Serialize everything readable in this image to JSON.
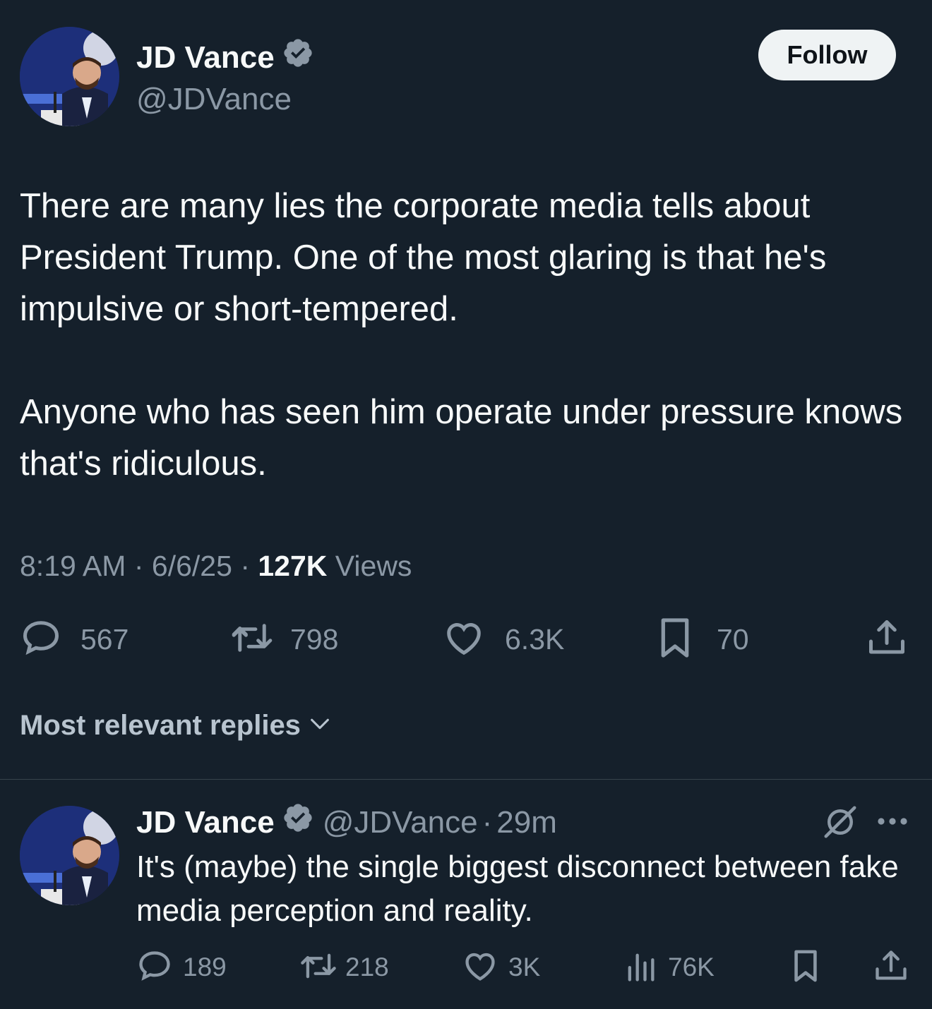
{
  "tweet": {
    "author_name": "JD Vance",
    "handle": "@JDVance",
    "follow_label": "Follow",
    "text_p1": "There are many lies the corporate media tells about President Trump. One of the most glaring is that he's impulsive or short-tempered.",
    "text_p2": "Anyone who has seen him operate under pressure knows that's ridiculous.",
    "time": "8:19 AM",
    "date": "6/6/25",
    "views_count": "127K",
    "views_label": "Views",
    "sep": "·",
    "replies": "567",
    "reposts": "798",
    "likes": "6.3K",
    "bookmarks": "70"
  },
  "replies_sort": {
    "label": "Most relevant replies"
  },
  "reply": {
    "author_name": "JD Vance",
    "handle": "@JDVance",
    "time": "29m",
    "sep": "·",
    "text": "It's (maybe) the single biggest disconnect between fake media perception and reality.",
    "replies": "189",
    "reposts": "218",
    "likes": "3K",
    "views": "76K"
  },
  "icons": {
    "verified": "verified-badge-icon",
    "reply": "speech-bubble-icon",
    "repost": "repost-arrows-icon",
    "like": "heart-icon",
    "bookmark": "bookmark-icon",
    "share": "share-upload-icon",
    "views": "bar-chart-icon",
    "grok": "grok-slash-icon",
    "more": "more-dots-icon",
    "chevron": "chevron-down-icon"
  },
  "colors": {
    "background": "#15202b",
    "text": "#f7f9f9",
    "muted": "#8b98a5",
    "follow_bg": "#eff3f4",
    "divider": "#38444d"
  }
}
